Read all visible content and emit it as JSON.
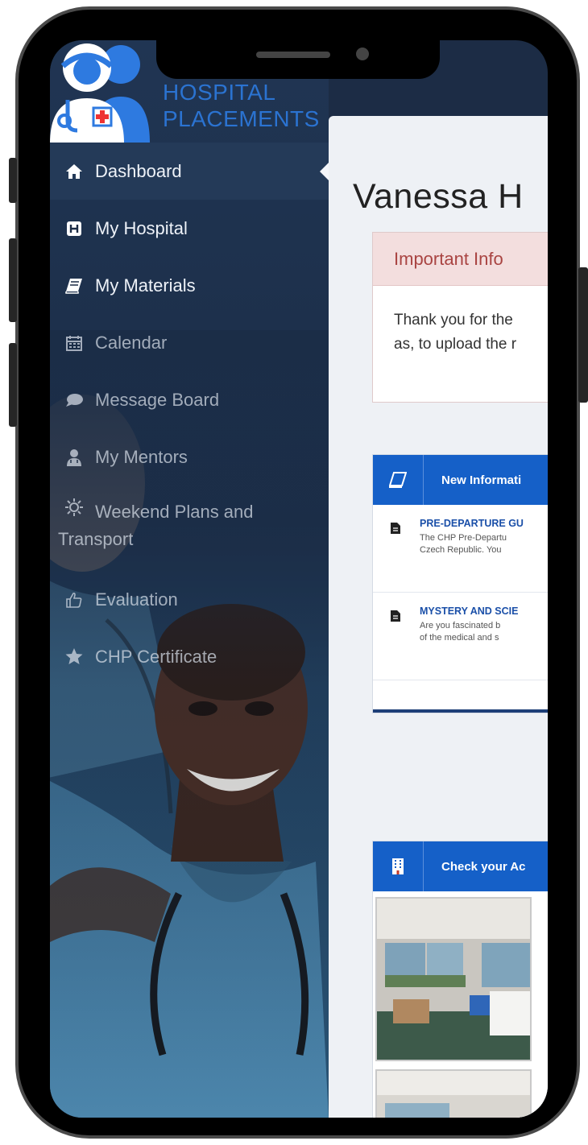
{
  "app": {
    "logo_line1": "HOSPITAL",
    "logo_line2": "PLACEMENTS"
  },
  "sidebar": {
    "items": [
      {
        "label": "Dashboard",
        "icon": "home-icon"
      },
      {
        "label": "My Hospital",
        "icon": "hospital-h-icon"
      },
      {
        "label": "My Materials",
        "icon": "book-icon"
      },
      {
        "label": "Calendar",
        "icon": "calendar-icon"
      },
      {
        "label": "Message Board",
        "icon": "speech-bubble-icon"
      },
      {
        "label": "My Mentors",
        "icon": "user-md-icon"
      },
      {
        "label": "Weekend Plans and Transport",
        "icon": "sun-icon"
      },
      {
        "label": "Evaluation",
        "icon": "thumbs-up-icon"
      },
      {
        "label": "CHP Certificate",
        "icon": "star-icon"
      }
    ]
  },
  "main": {
    "title": "Vanessa H",
    "info_box": {
      "heading": "Important Info",
      "line1": "Thank you for the",
      "line2": "as, to upload the r"
    },
    "news_card": {
      "title": "New Informati",
      "items": [
        {
          "title": "PRE-DEPARTURE GU",
          "line1": "The CHP Pre-Departu",
          "line2": "Czech Republic. You"
        },
        {
          "title": "MYSTERY AND SCIE",
          "line1": "Are you fascinated b",
          "line2": "of the medical and s"
        }
      ]
    },
    "accommodation_card": {
      "title": "Check your Ac"
    }
  },
  "colors": {
    "sidebar_bg": "#1c2c45",
    "accent_blue": "#1560c8",
    "logo_blue": "#2b73d1",
    "info_heading": "#a94442"
  }
}
